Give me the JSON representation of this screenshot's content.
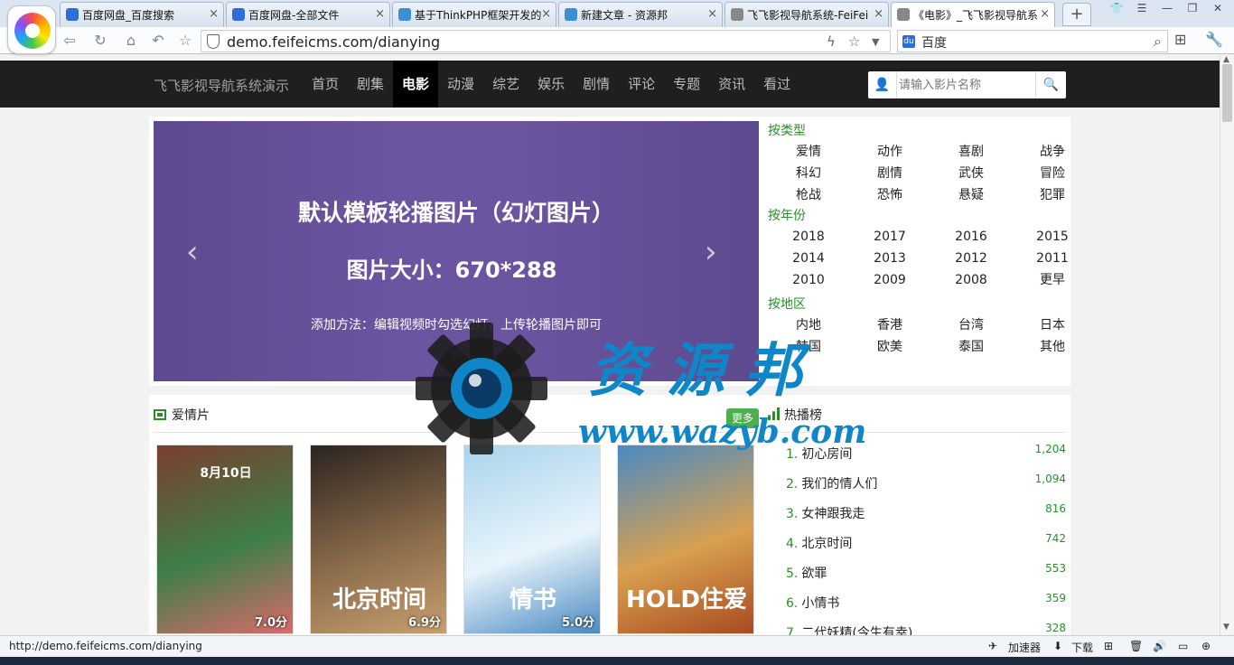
{
  "browser": {
    "tabs": [
      {
        "label": "百度网盘_百度搜索",
        "icon": "paw-icon",
        "color": "#2f6dd6"
      },
      {
        "label": "百度网盘-全部文件",
        "icon": "cloud-icon",
        "color": "#2f6dd6"
      },
      {
        "label": "基于ThinkPHP框架开发的",
        "icon": "site-icon",
        "color": "#3b8fd4"
      },
      {
        "label": "新建文章 - 资源邦",
        "icon": "site-icon",
        "color": "#3b8fd4"
      },
      {
        "label": "飞飞影视导航系统-FeiFei",
        "icon": "page-icon",
        "color": "#888888"
      },
      {
        "label": "《电影》_飞飞影视导航系",
        "icon": "page-icon",
        "color": "#888888"
      }
    ],
    "tab_close": "×",
    "new_tab": "+",
    "url": "demo.feifeicms.com/dianying",
    "search_engine": "百度",
    "status_url": "http://demo.feifeicms.com/dianying",
    "status_accel": "加速器",
    "status_download": "下载"
  },
  "site": {
    "brand": "飞飞影视导航系统演示",
    "menu": [
      "首页",
      "剧集",
      "电影",
      "动漫",
      "综艺",
      "娱乐",
      "剧情",
      "评论",
      "专题",
      "资讯",
      "看过"
    ],
    "active_menu": "电影",
    "search_placeholder": "请输入影片名称"
  },
  "slider": {
    "title": "默认模板轮播图片（幻灯图片）",
    "size": "图片大小：670*288",
    "note": "添加方法：编辑视频时勾选幻灯，上传轮播图片即可",
    "prev": "‹",
    "next": "›"
  },
  "filters": {
    "type_title": "按类型",
    "types": [
      "爱情",
      "动作",
      "喜剧",
      "战争",
      "科幻",
      "剧情",
      "武侠",
      "冒险",
      "枪战",
      "恐怖",
      "悬疑",
      "犯罪"
    ],
    "year_title": "按年份",
    "years": [
      "2018",
      "2017",
      "2016",
      "2015",
      "2014",
      "2013",
      "2012",
      "2011",
      "2010",
      "2009",
      "2008",
      "更早"
    ],
    "area_title": "按地区",
    "areas": [
      "内地",
      "香港",
      "台湾",
      "日本",
      "韩国",
      "欧美",
      "泰国",
      "其他"
    ]
  },
  "section": {
    "title": "爱情片",
    "more": "更多",
    "posters": [
      {
        "text": "8月10日",
        "score": "7.0分",
        "colors": [
          "#7a3f2d",
          "#3e7e4a",
          "#d96b6b"
        ]
      },
      {
        "text": "北京时间",
        "score": "6.9分",
        "colors": [
          "#2b2420",
          "#8a6b4a",
          "#c8a070"
        ]
      },
      {
        "text": "情书",
        "score": "5.0分",
        "colors": [
          "#a9d4ec",
          "#e8f4fb",
          "#4a8ac2"
        ]
      },
      {
        "text": "HOLD住爱",
        "score": "",
        "colors": [
          "#4a8ac2",
          "#d8a050",
          "#a84a20"
        ]
      }
    ]
  },
  "ranking": {
    "title": "热播榜",
    "items": [
      {
        "n": "1.",
        "name": "初心房间",
        "count": "1,204"
      },
      {
        "n": "2.",
        "name": "我们的情人们",
        "count": "1,094"
      },
      {
        "n": "3.",
        "name": "女神跟我走",
        "count": "816"
      },
      {
        "n": "4.",
        "name": "北京时间",
        "count": "742"
      },
      {
        "n": "5.",
        "name": "欲罪",
        "count": "553"
      },
      {
        "n": "6.",
        "name": "小情书",
        "count": "359"
      },
      {
        "n": "7.",
        "name": "二代妖精(今生有幸)",
        "count": "328"
      }
    ]
  },
  "watermark": {
    "zh": "资源邦",
    "en": "www.wazyb.com"
  }
}
